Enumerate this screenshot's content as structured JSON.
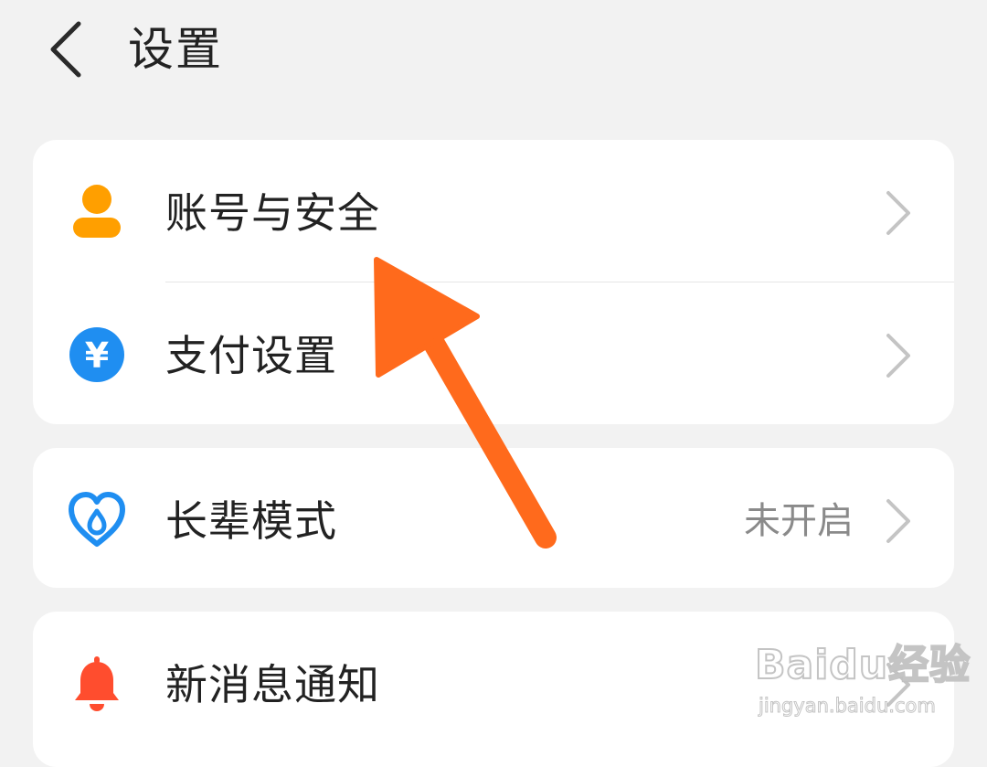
{
  "header": {
    "title": "设置",
    "back_icon": "chevron-left-icon"
  },
  "groups": [
    {
      "items": [
        {
          "label": "账号与安全",
          "icon": "account-icon",
          "icon_color": "#ff9f00",
          "value": ""
        },
        {
          "label": "支付设置",
          "icon": "yuan-icon",
          "icon_color": "#1f8ef1",
          "value": ""
        }
      ]
    },
    {
      "items": [
        {
          "label": "长辈模式",
          "icon": "heart-icon",
          "icon_color": "#1f8ef1",
          "value": "未开启"
        }
      ]
    },
    {
      "items": [
        {
          "label": "新消息通知",
          "icon": "bell-icon",
          "icon_color": "#ff4d2e",
          "value": ""
        }
      ]
    }
  ],
  "icons": {
    "yuan_symbol": "¥"
  },
  "annotation": {
    "type": "arrow",
    "color": "#ff6a1c",
    "points_to": "账号与安全"
  },
  "watermark": {
    "brand": "Baidu经验",
    "url": "jingyan.baidu.com"
  },
  "colors": {
    "background": "#f2f2f2",
    "card": "#ffffff",
    "text_primary": "#222222",
    "text_secondary": "#8a8a8a",
    "chevron": "#c4c4c4"
  }
}
